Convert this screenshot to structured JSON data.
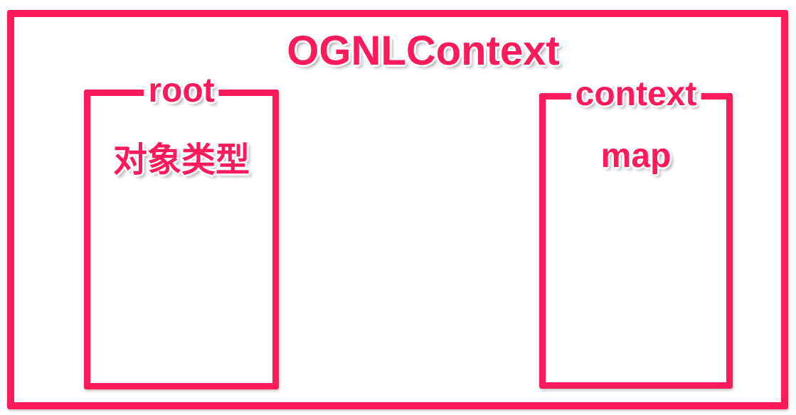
{
  "diagram": {
    "title": "OGNLContext",
    "boxes": [
      {
        "label": "root",
        "content": "对象类型"
      },
      {
        "label": "context",
        "content": "map"
      }
    ]
  },
  "colors": {
    "accent": "#fe1a5b",
    "background": "#ffffff"
  }
}
